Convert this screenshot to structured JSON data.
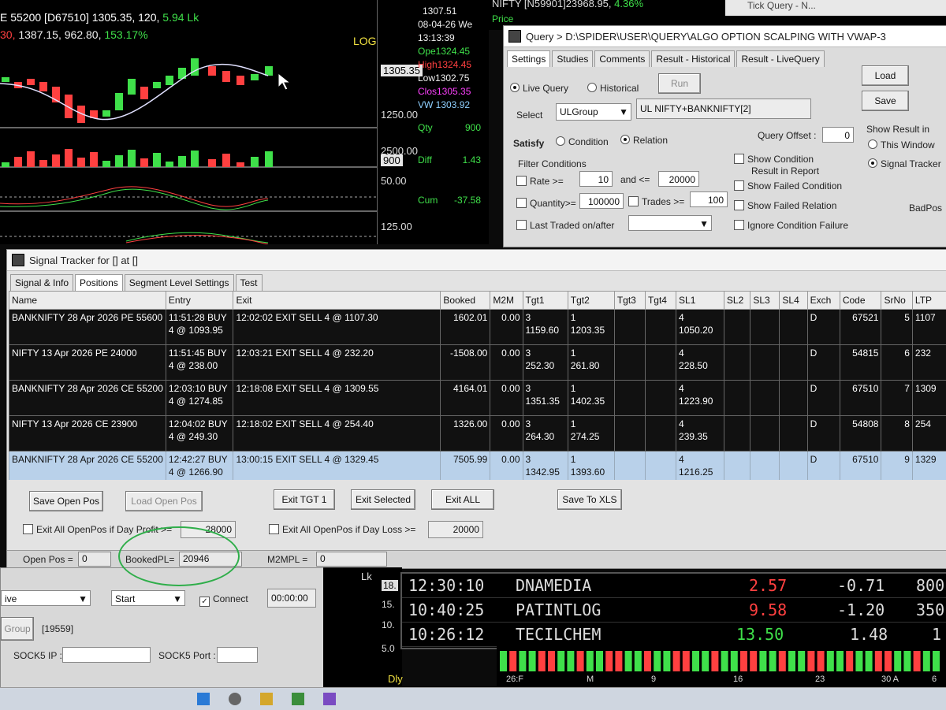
{
  "chart_window": {
    "header_line1": "E 55200 [D67510] 1305.35, 120,",
    "header_green1": "5.94 Lk",
    "header_line2_red": "30,",
    "header_line2": "1387.15, 962.80,",
    "header_green2": "153.17%",
    "log_label": "LOG",
    "price_labels": [
      "1305.35",
      "1250.00",
      "2500.00",
      "900",
      "50.00",
      "125.00"
    ],
    "info": {
      "price": "1307.51",
      "date": "08-04-26 We",
      "time": "13:13:39",
      "open": "Ope1324.45",
      "high": "High1324.45",
      "low": "Low1302.75",
      "close": "Clos1305.35",
      "vwap": "VW 1303.92",
      "qty_label": "Qty",
      "qty": "900",
      "diff_label": "Diff",
      "diff": "1.43",
      "cum_label": "Cum",
      "cum": "-37.58"
    }
  },
  "top_strip": {
    "text": "NIFTY [N59901]23968.95,",
    "change": "4.36%",
    "price_label": "Price",
    "tick_query_title": "Tick Query - N..."
  },
  "query_window": {
    "title": "Query > D:\\SPIDER\\USER\\QUERY\\ALGO OPTION SCALPING WITH VWAP-3",
    "tabs": [
      "Settings",
      "Studies",
      "Comments",
      "Result - Historical",
      "Result - LiveQuery"
    ],
    "live_query": "Live Query",
    "historical": "Historical",
    "run": "Run",
    "load": "Load",
    "save": "Save",
    "select_label": "Select",
    "select_value": "ULGroup",
    "select_display": "UL NIFTY+BANKNIFTY[2]",
    "satisfy": "Satisfy",
    "condition": "Condition",
    "relation": "Relation",
    "query_offset_label": "Query Offset :",
    "query_offset": "0",
    "show_result_in": "Show Result in",
    "this_window": "This Window",
    "signal_tracker": "Signal Tracker",
    "filter_conditions": "Filter Conditions",
    "rate_label": "Rate >=",
    "rate_min": "10",
    "and_le": "and <=",
    "rate_max": "20000",
    "quantity_label": "Quantity>=",
    "quantity": "100000",
    "trades_label": "Trades >=",
    "trades": "100",
    "last_traded": "Last Traded on/after",
    "show_condition": "Show Condition",
    "result_in_report": "Result in Report",
    "show_failed_condition": "Show Failed Condition",
    "show_failed_relation": "Show Failed Relation",
    "ignore_condition_failure": "Ignore Condition Failure",
    "badpos": "BadPos"
  },
  "tracker": {
    "title": "Signal Tracker for [] at []",
    "tabs": [
      "Signal & Info",
      "Positions",
      "Segment Level Settings",
      "Test"
    ],
    "columns": [
      "Name",
      "Entry",
      "Exit",
      "Booked",
      "M2M",
      "Tgt1",
      "Tgt2",
      "Tgt3",
      "Tgt4",
      "SL1",
      "SL2",
      "SL3",
      "SL4",
      "Exch",
      "Code",
      "SrNo",
      "LTP"
    ],
    "rows": [
      {
        "name": "BANKNIFTY 28 Apr 2026 PE 55600",
        "entry1": "11:51:28 BUY",
        "entry2": "4 @ 1093.95",
        "exit": "12:02:02 EXIT SELL 4 @  1107.30",
        "booked": "1602.01",
        "m2m": "0.00",
        "tgt1a": "3",
        "tgt1b": "1159.60",
        "tgt2a": "1",
        "tgt2b": "1203.35",
        "sl1a": "4",
        "sl1b": "1050.20",
        "exch": "D",
        "code": "67521",
        "srno": "5",
        "ltp": "1107"
      },
      {
        "name": "NIFTY 13 Apr 2026 PE 24000",
        "entry1": "11:51:45 BUY",
        "entry2": "4 @ 238.00",
        "exit": "12:03:21 EXIT SELL 4 @  232.20",
        "booked": "-1508.00",
        "m2m": "0.00",
        "tgt1a": "3",
        "tgt1b": "252.30",
        "tgt2a": "1",
        "tgt2b": "261.80",
        "sl1a": "4",
        "sl1b": "228.50",
        "exch": "D",
        "code": "54815",
        "srno": "6",
        "ltp": "232"
      },
      {
        "name": "BANKNIFTY 28 Apr 2026 CE 55200",
        "entry1": "12:03:10 BUY",
        "entry2": "4 @ 1274.85",
        "exit": "12:18:08 EXIT SELL 4 @  1309.55",
        "booked": "4164.01",
        "m2m": "0.00",
        "tgt1a": "3",
        "tgt1b": "1351.35",
        "tgt2a": "1",
        "tgt2b": "1402.35",
        "sl1a": "4",
        "sl1b": "1223.90",
        "exch": "D",
        "code": "67510",
        "srno": "7",
        "ltp": "1309"
      },
      {
        "name": "NIFTY 13 Apr 2026 CE 23900",
        "entry1": "12:04:02 BUY",
        "entry2": "4 @ 249.30",
        "exit": "12:18:02 EXIT SELL 4 @  254.40",
        "booked": "1326.00",
        "m2m": "0.00",
        "tgt1a": "3",
        "tgt1b": "264.30",
        "tgt2a": "1",
        "tgt2b": "274.25",
        "sl1a": "4",
        "sl1b": "239.35",
        "exch": "D",
        "code": "54808",
        "srno": "8",
        "ltp": "254"
      },
      {
        "name": "BANKNIFTY 28 Apr 2026 CE 55200",
        "entry1": "12:42:27 BUY",
        "entry2": "4 @ 1266.90",
        "exit": "13:00:15 EXIT SELL 4 @  1329.45",
        "booked": "7505.99",
        "m2m": "0.00",
        "tgt1a": "3",
        "tgt1b": "1342.95",
        "tgt2a": "1",
        "tgt2b": "1393.60",
        "sl1a": "4",
        "sl1b": "1216.25",
        "exch": "D",
        "code": "67510",
        "srno": "9",
        "ltp": "1329"
      }
    ],
    "buttons": {
      "save_open_pos": "Save Open Pos",
      "load_open_pos": "Load Open Pos",
      "exit_tgt1": "Exit TGT 1",
      "exit_selected": "Exit Selected",
      "exit_all": "Exit ALL",
      "save_to_xls": "Save To XLS"
    },
    "exit_profit_label": "Exit All OpenPos if Day Profit >=",
    "exit_profit_value": "28000",
    "exit_loss_label": "Exit All OpenPos if Day Loss >=",
    "exit_loss_value": "20000",
    "status": {
      "open_pos_label": "Open Pos =",
      "open_pos": "0",
      "booked_pl_label": "BookedPL=",
      "booked_pl": "20946",
      "m2mpl_label": "M2MPL =",
      "m2mpl": "0"
    }
  },
  "bottom_left": {
    "live_select": "ive",
    "start_select": "Start",
    "connect": "Connect",
    "timer": "00:00:00",
    "group_btn": "Group",
    "group_count": "[19559]",
    "socks5_ip": "SOCK5 IP :",
    "socks5_port": "SOCK5 Port :"
  },
  "bottom_mid": {
    "lk": "Lk",
    "labels": [
      "18.",
      "15.",
      "10.",
      "5.0"
    ],
    "dly": "Dly"
  },
  "ticker": [
    {
      "time": "12:30:10",
      "symbol": "DNAMEDIA",
      "price": "2.57",
      "change": "-0.71",
      "vol": "800"
    },
    {
      "time": "10:40:25",
      "symbol": "PATINTLOG",
      "price": "9.58",
      "change": "-1.20",
      "vol": "350"
    },
    {
      "time": "10:26:12",
      "symbol": "TECILCHEM",
      "price": "13.50",
      "change": "1.48",
      "vol": "1"
    }
  ],
  "mini_chart_labels": [
    "26:F",
    "M",
    "9",
    "16",
    "23",
    "30 A",
    "6"
  ],
  "colors": {
    "up": "#3fe04a",
    "down": "#ff4040",
    "annotation": "#2fae4a",
    "selected_row": "#b9d1ea"
  }
}
